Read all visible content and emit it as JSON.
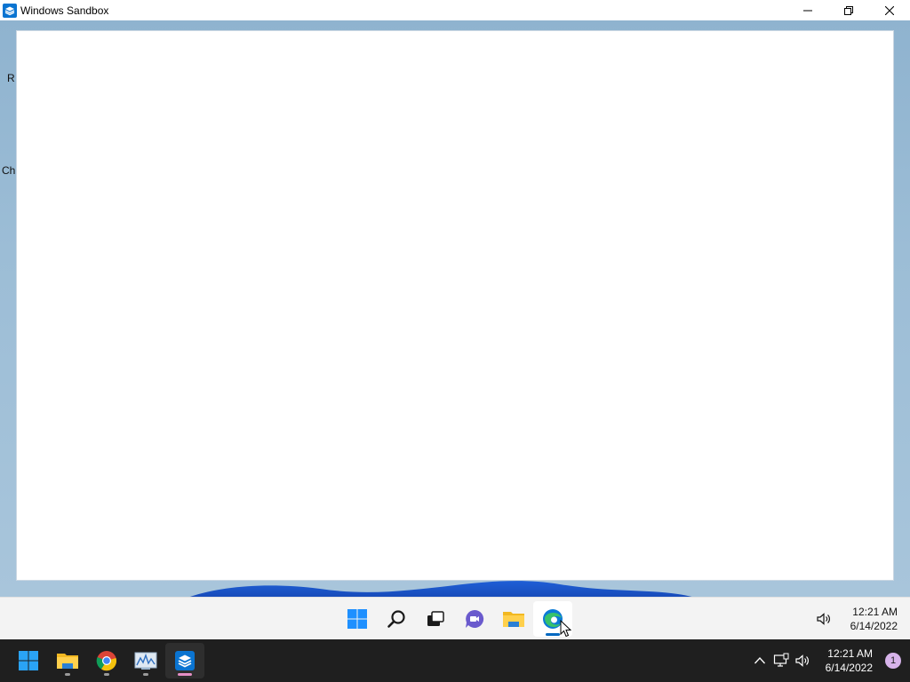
{
  "window": {
    "title": "Windows Sandbox",
    "icon": "sandbox-icon",
    "controls": {
      "minimize": "minimize-icon",
      "restore": "restore-icon",
      "close": "close-icon"
    }
  },
  "desktop": {
    "fragments": [
      "R",
      "Ch"
    ]
  },
  "guest_taskbar": {
    "items": [
      {
        "name": "start",
        "icon": "windows-start-icon"
      },
      {
        "name": "search",
        "icon": "search-icon"
      },
      {
        "name": "task-view",
        "icon": "task-view-icon"
      },
      {
        "name": "chat",
        "icon": "teams-chat-icon"
      },
      {
        "name": "file-explorer",
        "icon": "folder-icon"
      },
      {
        "name": "edge",
        "icon": "edge-icon",
        "active": true
      }
    ],
    "tray": {
      "volume_icon": "volume-icon"
    },
    "clock": {
      "time": "12:21 AM",
      "date": "6/14/2022"
    }
  },
  "host_taskbar": {
    "items": [
      {
        "name": "start",
        "icon": "windows-start-icon"
      },
      {
        "name": "file-explorer",
        "icon": "folder-icon"
      },
      {
        "name": "chrome",
        "icon": "chrome-icon"
      },
      {
        "name": "performance-monitor",
        "icon": "monitor-chart-icon"
      },
      {
        "name": "windows-sandbox",
        "icon": "sandbox-icon",
        "active": true
      }
    ],
    "tray": {
      "chevron": "chevron-up-icon",
      "network": "network-icon",
      "volume": "volume-icon"
    },
    "clock": {
      "time": "12:21 AM",
      "date": "6/14/2022"
    },
    "notification_count": "1"
  },
  "colors": {
    "accent": "#0067c0",
    "host_taskbar_bg": "#1f1f1f",
    "guest_taskbar_bg": "#f3f3f3",
    "desktop_bg": "#9cbdd6",
    "notification_badge": "#d7b3ea"
  }
}
